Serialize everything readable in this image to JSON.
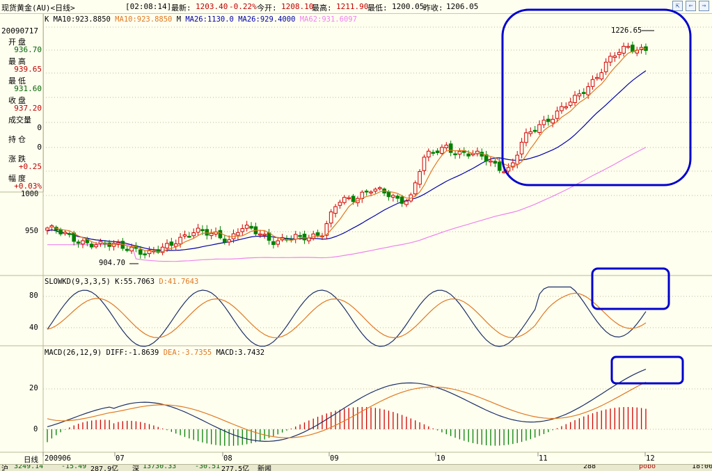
{
  "header": {
    "instrument": "现货黄金(AU)<日线>",
    "time": "[02:08:14]",
    "latest_label": "最新:",
    "latest_value": "1203.40",
    "change": "-0.22%",
    "open_label": "今开:",
    "open_value": "1208.10",
    "high_label": "最高:",
    "high_value": "1211.90",
    "low_label": "最低:",
    "low_value": "1200.05",
    "prev_label": "昨收:",
    "prev_value": "1206.05"
  },
  "info_panel": {
    "date": "20090717",
    "open_label": "开盘",
    "open": "936.70",
    "high_label": "最高",
    "high": "939.65",
    "low_label": "最低",
    "low": "931.60",
    "close_label": "收盘",
    "close": "937.20",
    "volume_label": "成交量",
    "volume": "0",
    "oi_label": "持仓",
    "oi": "0",
    "change_label": "涨跌",
    "change": "+0.25",
    "pct_label": "幅度",
    "pct": "+0.03%"
  },
  "price_legend": {
    "k": "K",
    "ma10a": "MA10:923.8850",
    "ma10b": "MA10:923.8850",
    "m": "M",
    "ma26": "MA26:1130.0",
    "ma26_cut": "MA26:929.4000",
    "ma62": "MA62:931.6097"
  },
  "kd_legend": {
    "name": "SLOWKD(9,3,3,5)",
    "k": "K:55.7063",
    "d": "D:41.7643"
  },
  "macd_legend": {
    "name": "MACD(26,12,9)",
    "diff": "DIFF:-1.8639",
    "dea": "DEA:-3.7355",
    "macd": "MACD:3.7432"
  },
  "annotations": {
    "high_peak": "1226.65",
    "low_trough": "904.70"
  },
  "x_axis": {
    "label": "日线",
    "ticks": [
      "200906",
      "07",
      "08",
      "09",
      "10",
      "11",
      "12"
    ]
  },
  "price_axis": {
    "ticks": [
      "1000",
      "950"
    ]
  },
  "kd_axis": {
    "ticks": [
      "80",
      "40"
    ]
  },
  "macd_axis": {
    "ticks": [
      "20",
      "0"
    ]
  },
  "status": {
    "a": "沪",
    "b": "3249.14",
    "c": "-15.49",
    "d": "287.9亿",
    "e": "深",
    "f": "13730.33",
    "g": "-30.51",
    "h": "277.5亿",
    "i": "新闻",
    "j": "288",
    "k": "pobo",
    "l": "18:00"
  },
  "colors": {
    "up": "#d00000",
    "down": "#008000",
    "ma10": "#e07820",
    "ma26": "#0000a8",
    "ma62": "#ee82ee",
    "highlight": "#0000cc"
  }
}
